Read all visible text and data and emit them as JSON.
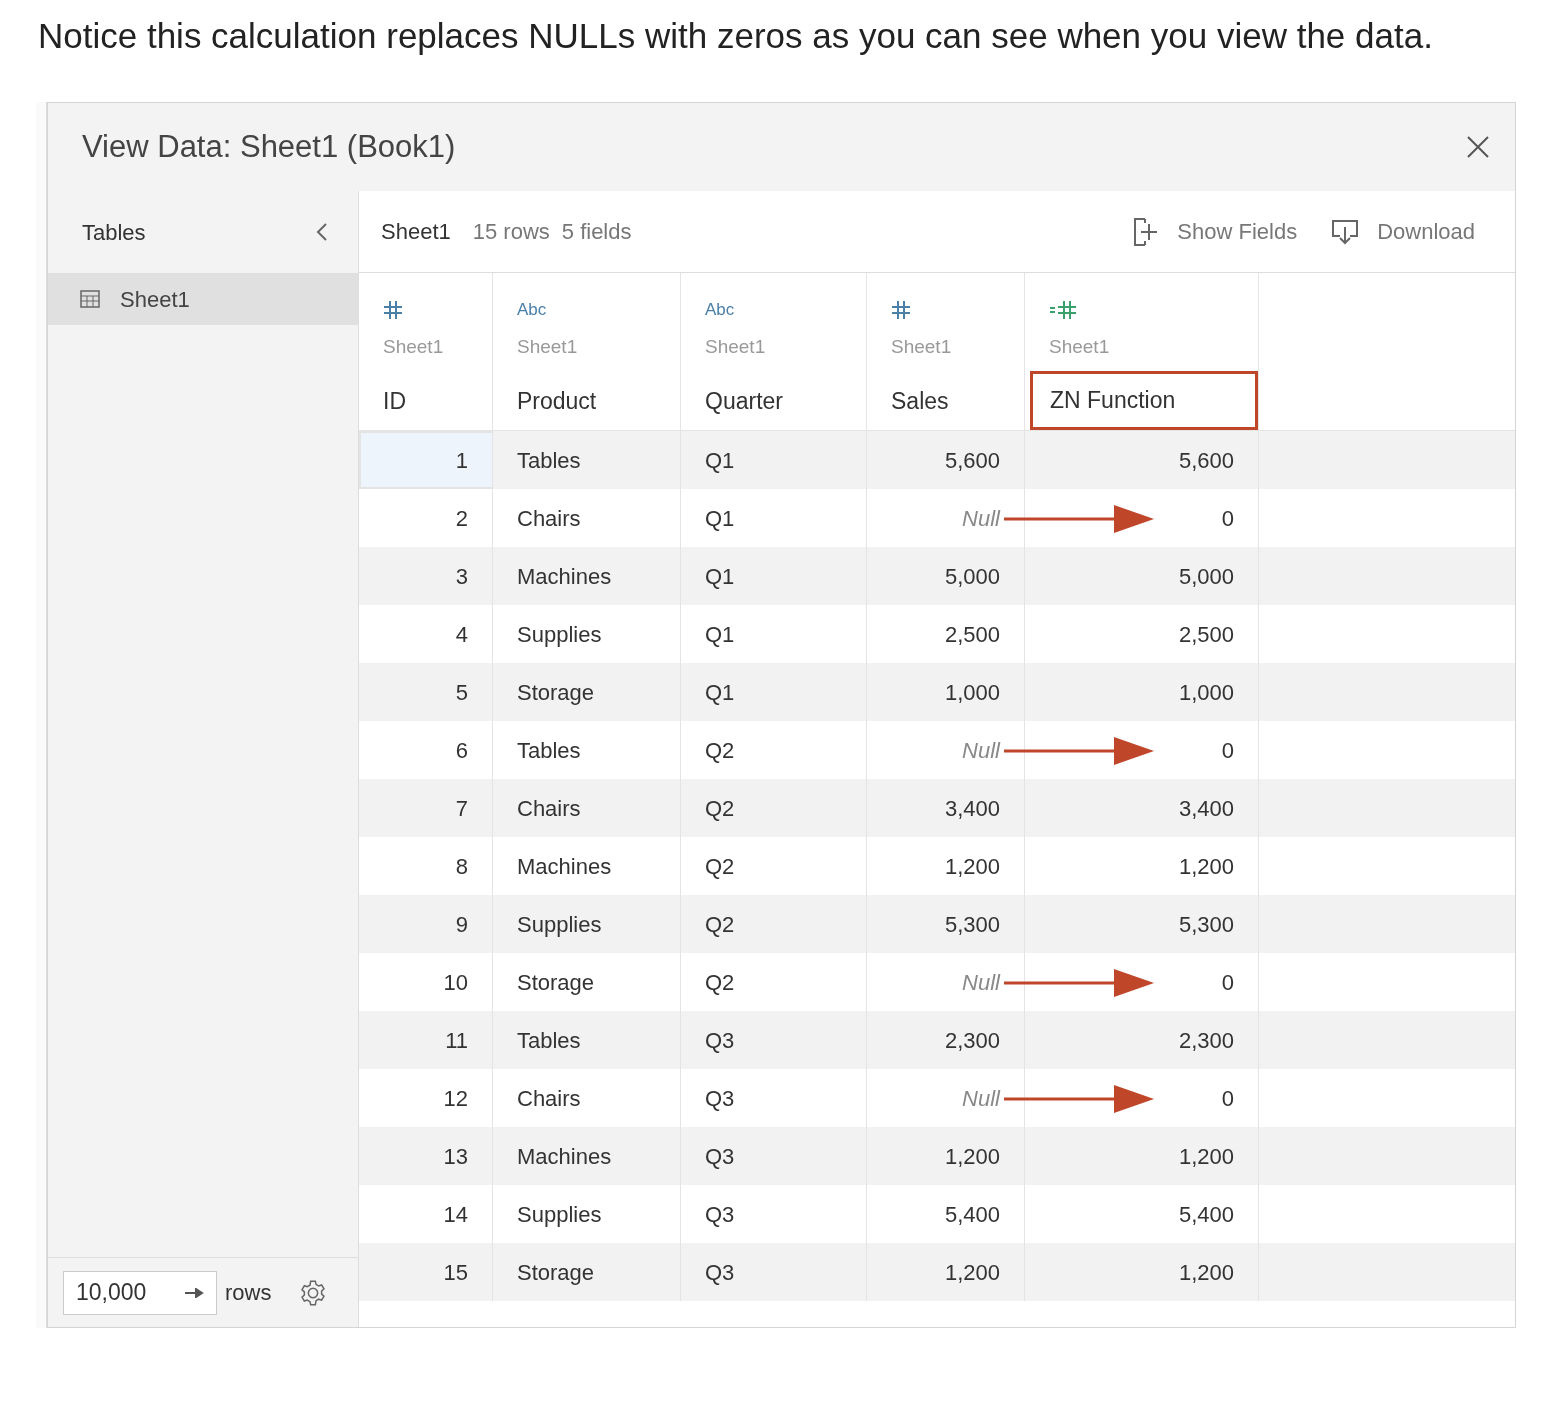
{
  "intro": "Notice this calculation replaces NULLs with zeros as you can see when you view the data.",
  "dialog": {
    "title": "View Data: Sheet1 (Book1)",
    "sidebar": {
      "heading": "Tables",
      "items": [
        {
          "label": "Sheet1",
          "selected": true
        }
      ],
      "row_limit": "10,000",
      "rows_label": "rows"
    },
    "toolbar": {
      "table": "Sheet1",
      "row_count": "15 rows",
      "field_count": "5 fields",
      "buttons": [
        {
          "kind": "show_fields",
          "label": "Show Fields"
        },
        {
          "kind": "download",
          "label": "Download"
        }
      ]
    },
    "columns": [
      {
        "kind": "number",
        "source": "Sheet1",
        "name": "ID",
        "highlighted": false
      },
      {
        "kind": "string",
        "type_label": "Abc",
        "source": "Sheet1",
        "name": "Product",
        "highlighted": false
      },
      {
        "kind": "string",
        "type_label": "Abc",
        "source": "Sheet1",
        "name": "Quarter",
        "highlighted": false
      },
      {
        "kind": "number",
        "source": "Sheet1",
        "name": "Sales",
        "highlighted": false
      },
      {
        "kind": "calc",
        "source": "Sheet1",
        "name": "ZN Function",
        "highlighted": true
      }
    ],
    "rows": [
      {
        "cells": [
          "1",
          "Tables",
          "Q1",
          "5,600",
          "5,600"
        ],
        "null_sales": false,
        "arrow": false,
        "selected": true
      },
      {
        "cells": [
          "2",
          "Chairs",
          "Q1",
          "Null",
          "0"
        ],
        "null_sales": true,
        "arrow": true,
        "selected": false
      },
      {
        "cells": [
          "3",
          "Machines",
          "Q1",
          "5,000",
          "5,000"
        ],
        "null_sales": false,
        "arrow": false,
        "selected": false
      },
      {
        "cells": [
          "4",
          "Supplies",
          "Q1",
          "2,500",
          "2,500"
        ],
        "null_sales": false,
        "arrow": false,
        "selected": false
      },
      {
        "cells": [
          "5",
          "Storage",
          "Q1",
          "1,000",
          "1,000"
        ],
        "null_sales": false,
        "arrow": false,
        "selected": false
      },
      {
        "cells": [
          "6",
          "Tables",
          "Q2",
          "Null",
          "0"
        ],
        "null_sales": true,
        "arrow": true,
        "selected": false
      },
      {
        "cells": [
          "7",
          "Chairs",
          "Q2",
          "3,400",
          "3,400"
        ],
        "null_sales": false,
        "arrow": false,
        "selected": false
      },
      {
        "cells": [
          "8",
          "Machines",
          "Q2",
          "1,200",
          "1,200"
        ],
        "null_sales": false,
        "arrow": false,
        "selected": false
      },
      {
        "cells": [
          "9",
          "Supplies",
          "Q2",
          "5,300",
          "5,300"
        ],
        "null_sales": false,
        "arrow": false,
        "selected": false
      },
      {
        "cells": [
          "10",
          "Storage",
          "Q2",
          "Null",
          "0"
        ],
        "null_sales": true,
        "arrow": true,
        "selected": false
      },
      {
        "cells": [
          "11",
          "Tables",
          "Q3",
          "2,300",
          "2,300"
        ],
        "null_sales": false,
        "arrow": false,
        "selected": false
      },
      {
        "cells": [
          "12",
          "Chairs",
          "Q3",
          "Null",
          "0"
        ],
        "null_sales": true,
        "arrow": true,
        "selected": false
      },
      {
        "cells": [
          "13",
          "Machines",
          "Q3",
          "1,200",
          "1,200"
        ],
        "null_sales": false,
        "arrow": false,
        "selected": false
      },
      {
        "cells": [
          "14",
          "Supplies",
          "Q3",
          "5,400",
          "5,400"
        ],
        "null_sales": false,
        "arrow": false,
        "selected": false
      },
      {
        "cells": [
          "15",
          "Storage",
          "Q3",
          "1,200",
          "1,200"
        ],
        "null_sales": false,
        "arrow": false,
        "selected": false
      }
    ]
  }
}
